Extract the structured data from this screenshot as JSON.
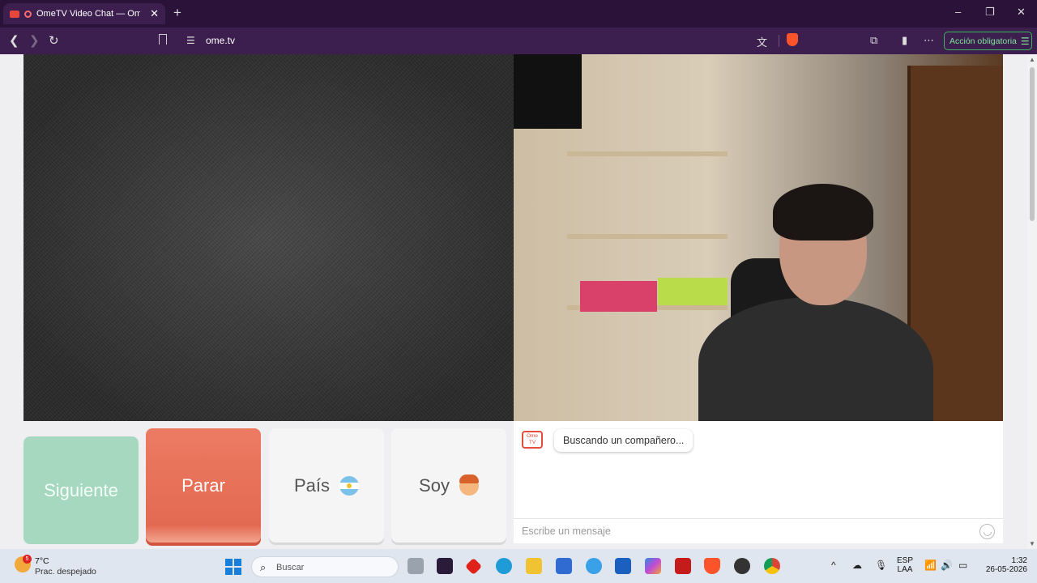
{
  "browser": {
    "tab_title": "OmeTV Video Chat — Omegl",
    "tab_close": "✕",
    "new_tab": "+",
    "url": "ome.tv",
    "action_button": "Acción obligatoria",
    "window_controls": {
      "minimize": "–",
      "maximize": "❐",
      "close": "✕"
    }
  },
  "buttons": {
    "next": "Siguiente",
    "stop": "Parar",
    "country": "País",
    "gender": "Soy"
  },
  "chat": {
    "status_message": "Buscando un compañero...",
    "logo_line1": "Ome",
    "logo_line2": "TV",
    "input_placeholder": "Escribe un mensaje"
  },
  "taskbar": {
    "weather_temp": "7°C",
    "weather_desc": "Prac. despejado",
    "weather_badge": "5",
    "search_label": "Buscar",
    "lang_line1": "ESP",
    "lang_line2": "LAA",
    "time": "1:32",
    "date": "26-05-2026"
  },
  "colors": {
    "accent_browser": "#3c1f4f",
    "next_button": "#a5d8bf",
    "stop_button": "#e36a52",
    "brand": "#e84c3d"
  }
}
